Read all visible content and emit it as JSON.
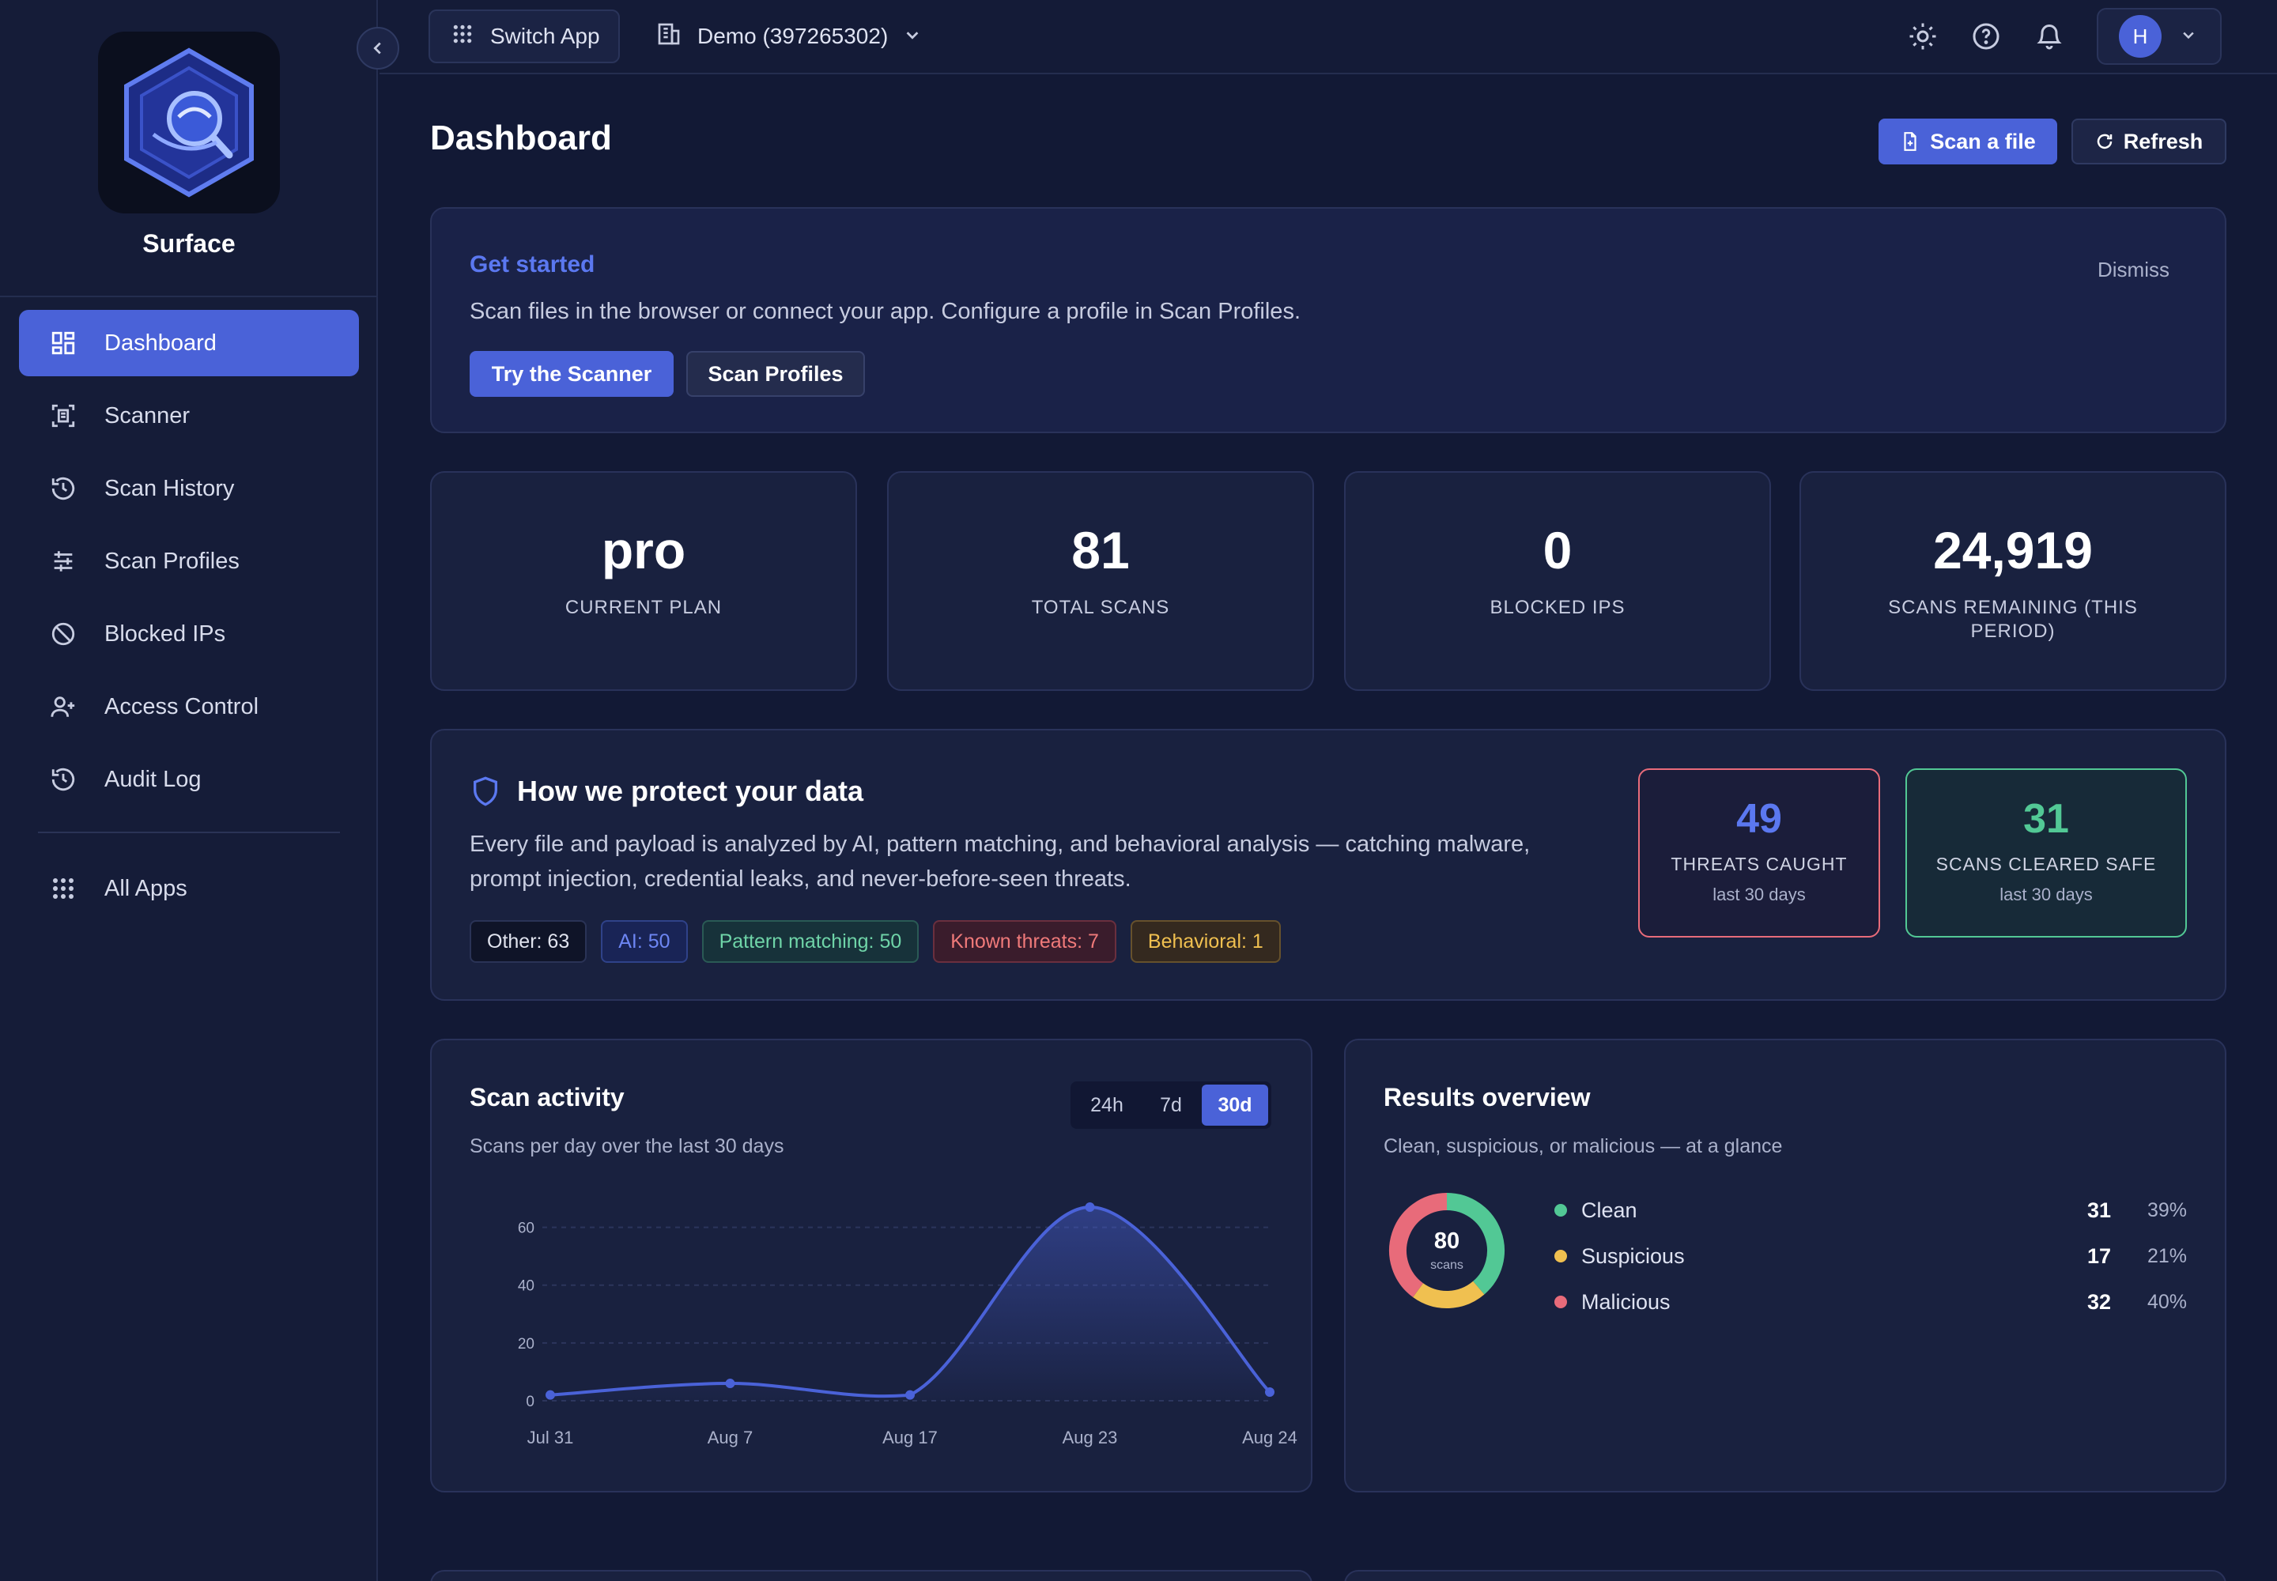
{
  "brand": {
    "name": "Surface"
  },
  "sidebar": {
    "items": [
      {
        "label": "Dashboard",
        "icon": "dashboard-icon",
        "active": true
      },
      {
        "label": "Scanner",
        "icon": "scanner-icon"
      },
      {
        "label": "Scan History",
        "icon": "history-icon"
      },
      {
        "label": "Scan Profiles",
        "icon": "sliders-icon"
      },
      {
        "label": "Blocked IPs",
        "icon": "ban-icon"
      },
      {
        "label": "Access Control",
        "icon": "user-plus-icon"
      },
      {
        "label": "Audit Log",
        "icon": "history-icon"
      }
    ],
    "all_apps": "All Apps"
  },
  "topbar": {
    "switch_app": "Switch App",
    "org": "Demo (397265302)",
    "avatar_initial": "H"
  },
  "page": {
    "title": "Dashboard",
    "scan_file": "Scan a file",
    "refresh": "Refresh"
  },
  "get_started": {
    "title": "Get started",
    "text": "Scan files in the browser or connect your app. Configure a profile in Scan Profiles.",
    "dismiss": "Dismiss",
    "try_scanner": "Try the Scanner",
    "scan_profiles": "Scan Profiles"
  },
  "stats": [
    {
      "value": "pro",
      "label": "CURRENT PLAN"
    },
    {
      "value": "81",
      "label": "TOTAL SCANS"
    },
    {
      "value": "0",
      "label": "BLOCKED IPS"
    },
    {
      "value": "24,919",
      "label": "SCANS REMAINING (THIS PERIOD)"
    }
  ],
  "protection": {
    "title": "How we protect your data",
    "text": "Every file and payload is analyzed by AI, pattern matching, and behavioral analysis — catching malware, prompt injection, credential leaks, and never-before-seen threats.",
    "tags": [
      "Other: 63",
      "AI: 50",
      "Pattern matching: 50",
      "Known threats: 7",
      "Behavioral: 1"
    ],
    "threats": {
      "value": "49",
      "label": "THREATS CAUGHT",
      "sub": "last 30 days"
    },
    "safe": {
      "value": "31",
      "label": "SCANS CLEARED SAFE",
      "sub": "last 30 days"
    }
  },
  "activity": {
    "title": "Scan activity",
    "subtitle": "Scans per day over the last 30 days",
    "ranges": [
      "24h",
      "7d",
      "30d"
    ],
    "active_range": "30d"
  },
  "results": {
    "title": "Results overview",
    "subtitle": "Clean, suspicious, or malicious — at a glance",
    "total": "80",
    "unit": "scans",
    "items": [
      {
        "name": "Clean",
        "count": "31",
        "pct": "39%",
        "color": "#52c895"
      },
      {
        "name": "Suspicious",
        "count": "17",
        "pct": "21%",
        "color": "#f0c050"
      },
      {
        "name": "Malicious",
        "count": "32",
        "pct": "40%",
        "color": "#e86b7a"
      }
    ]
  },
  "colors": {
    "accent": "#4a62d8",
    "background": "#121935",
    "card": "#19213f"
  },
  "chart_data": [
    {
      "type": "area",
      "title": "Scan activity",
      "x": [
        "Jul 31",
        "Aug 7",
        "Aug 17",
        "Aug 23",
        "Aug 24"
      ],
      "values": [
        2,
        6,
        2,
        67,
        3
      ],
      "ylim": [
        0,
        70
      ],
      "yticks": [
        0,
        20,
        40,
        60
      ],
      "grid": true,
      "color": "#4a62d8"
    },
    {
      "type": "pie",
      "title": "Results overview",
      "categories": [
        "Clean",
        "Suspicious",
        "Malicious"
      ],
      "values": [
        31,
        17,
        32
      ],
      "colors": [
        "#52c895",
        "#f0c050",
        "#e86b7a"
      ]
    }
  ]
}
